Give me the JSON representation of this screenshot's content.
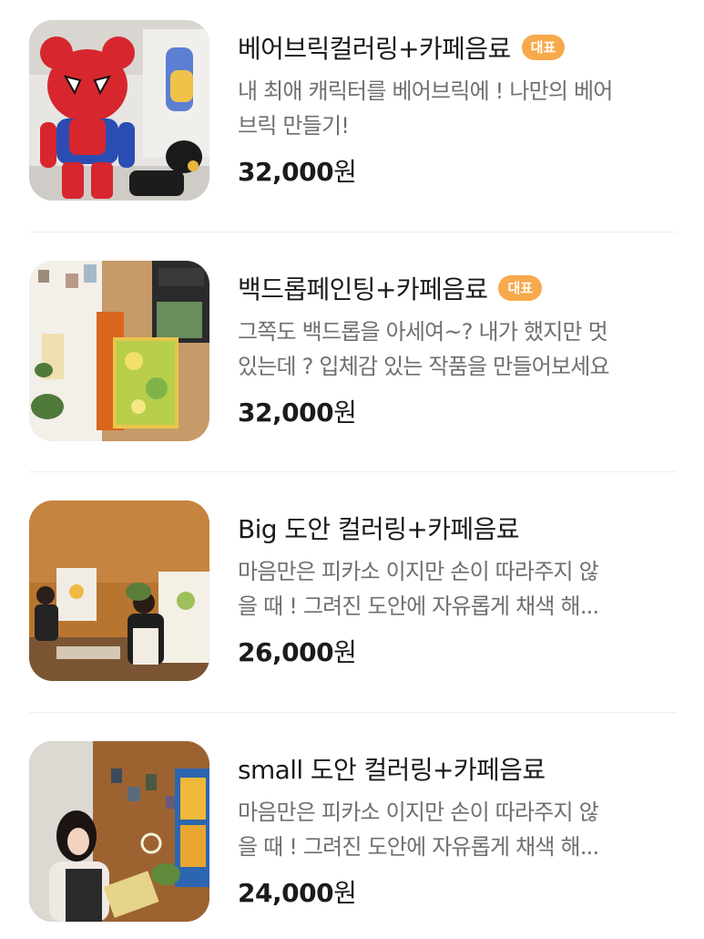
{
  "items": [
    {
      "title": "베어브릭컬러링+카페음료",
      "badge": "대표",
      "desc_line1": "내 최애 캐릭터를 베어브릭에 ! 나만의 베어",
      "desc_line2": "브릭 만들기!",
      "price": "32,000",
      "currency": "원",
      "image": "spiderman-bearbrick-photo"
    },
    {
      "title": "백드롭페인팅+카페음료",
      "badge": "대표",
      "desc_line1": "그쪽도 백드롭을 아세여~? 내가 했지만 멋",
      "desc_line2": "있는데 ? 입체감 있는 작품을 만들어보세요",
      "price": "32,000",
      "currency": "원",
      "image": "backdrop-painting-easel-photo"
    },
    {
      "title": "Big 도안 컬러링+카페음료",
      "badge": "",
      "desc_line1": "마음만은 피카소 이지만 손이 따라주지 않",
      "desc_line2": "을 때 ! 그려진 도안에 자유롭게 채색 해...",
      "price": "26,000",
      "currency": "원",
      "image": "people-painting-canvases-photo"
    },
    {
      "title": "small 도안 컬러링+카페음료",
      "badge": "",
      "desc_line1": "마음만은 피카소 이지만 손이 따라주지 않",
      "desc_line2": "을 때 ! 그려진 도안에 자유롭게 채색 해...",
      "price": "24,000",
      "currency": "원",
      "image": "woman-painting-small-canvas-photo"
    }
  ]
}
